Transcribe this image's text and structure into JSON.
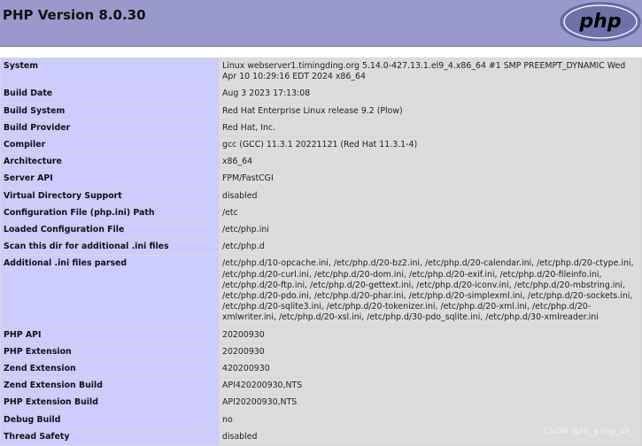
{
  "header": {
    "title": "PHP Version 8.0.30",
    "logo_text": "php"
  },
  "rows": [
    {
      "key": "System",
      "value": "Linux webserver1.timingding.org 5.14.0-427.13.1.el9_4.x86_64 #1 SMP PREEMPT_DYNAMIC Wed Apr 10 10:29:16 EDT 2024 x86_64"
    },
    {
      "key": "Build Date",
      "value": "Aug 3 2023 17:13:08"
    },
    {
      "key": "Build System",
      "value": "Red Hat Enterprise Linux release 9.2 (Plow)"
    },
    {
      "key": "Build Provider",
      "value": "Red Hat, Inc."
    },
    {
      "key": "Compiler",
      "value": "gcc (GCC) 11.3.1 20221121 (Red Hat 11.3.1-4)"
    },
    {
      "key": "Architecture",
      "value": "x86_64"
    },
    {
      "key": "Server API",
      "value": "FPM/FastCGI"
    },
    {
      "key": "Virtual Directory Support",
      "value": "disabled"
    },
    {
      "key": "Configuration File (php.ini) Path",
      "value": "/etc"
    },
    {
      "key": "Loaded Configuration File",
      "value": "/etc/php.ini"
    },
    {
      "key": "Scan this dir for additional .ini files",
      "value": "/etc/php.d"
    },
    {
      "key": "Additional .ini files parsed",
      "value": "/etc/php.d/10-opcache.ini, /etc/php.d/20-bz2.ini, /etc/php.d/20-calendar.ini, /etc/php.d/20-ctype.ini, /etc/php.d/20-curl.ini, /etc/php.d/20-dom.ini, /etc/php.d/20-exif.ini, /etc/php.d/20-fileinfo.ini, /etc/php.d/20-ftp.ini, /etc/php.d/20-gettext.ini, /etc/php.d/20-iconv.ini, /etc/php.d/20-mbstring.ini, /etc/php.d/20-pdo.ini, /etc/php.d/20-phar.ini, /etc/php.d/20-simplexml.ini, /etc/php.d/20-sockets.ini, /etc/php.d/20-sqlite3.ini, /etc/php.d/20-tokenizer.ini, /etc/php.d/20-xml.ini, /etc/php.d/20-xmlwriter.ini, /etc/php.d/20-xsl.ini, /etc/php.d/30-pdo_sqlite.ini, /etc/php.d/30-xmlreader.ini"
    },
    {
      "key": "PHP API",
      "value": "20200930"
    },
    {
      "key": "PHP Extension",
      "value": "20200930"
    },
    {
      "key": "Zend Extension",
      "value": "420200930"
    },
    {
      "key": "Zend Extension Build",
      "value": "API420200930,NTS"
    },
    {
      "key": "PHP Extension Build",
      "value": "API20200930,NTS"
    },
    {
      "key": "Debug Build",
      "value": "no"
    },
    {
      "key": "Thread Safety",
      "value": "disabled"
    }
  ],
  "watermark": "CSDN @Hi_yang_sir_"
}
